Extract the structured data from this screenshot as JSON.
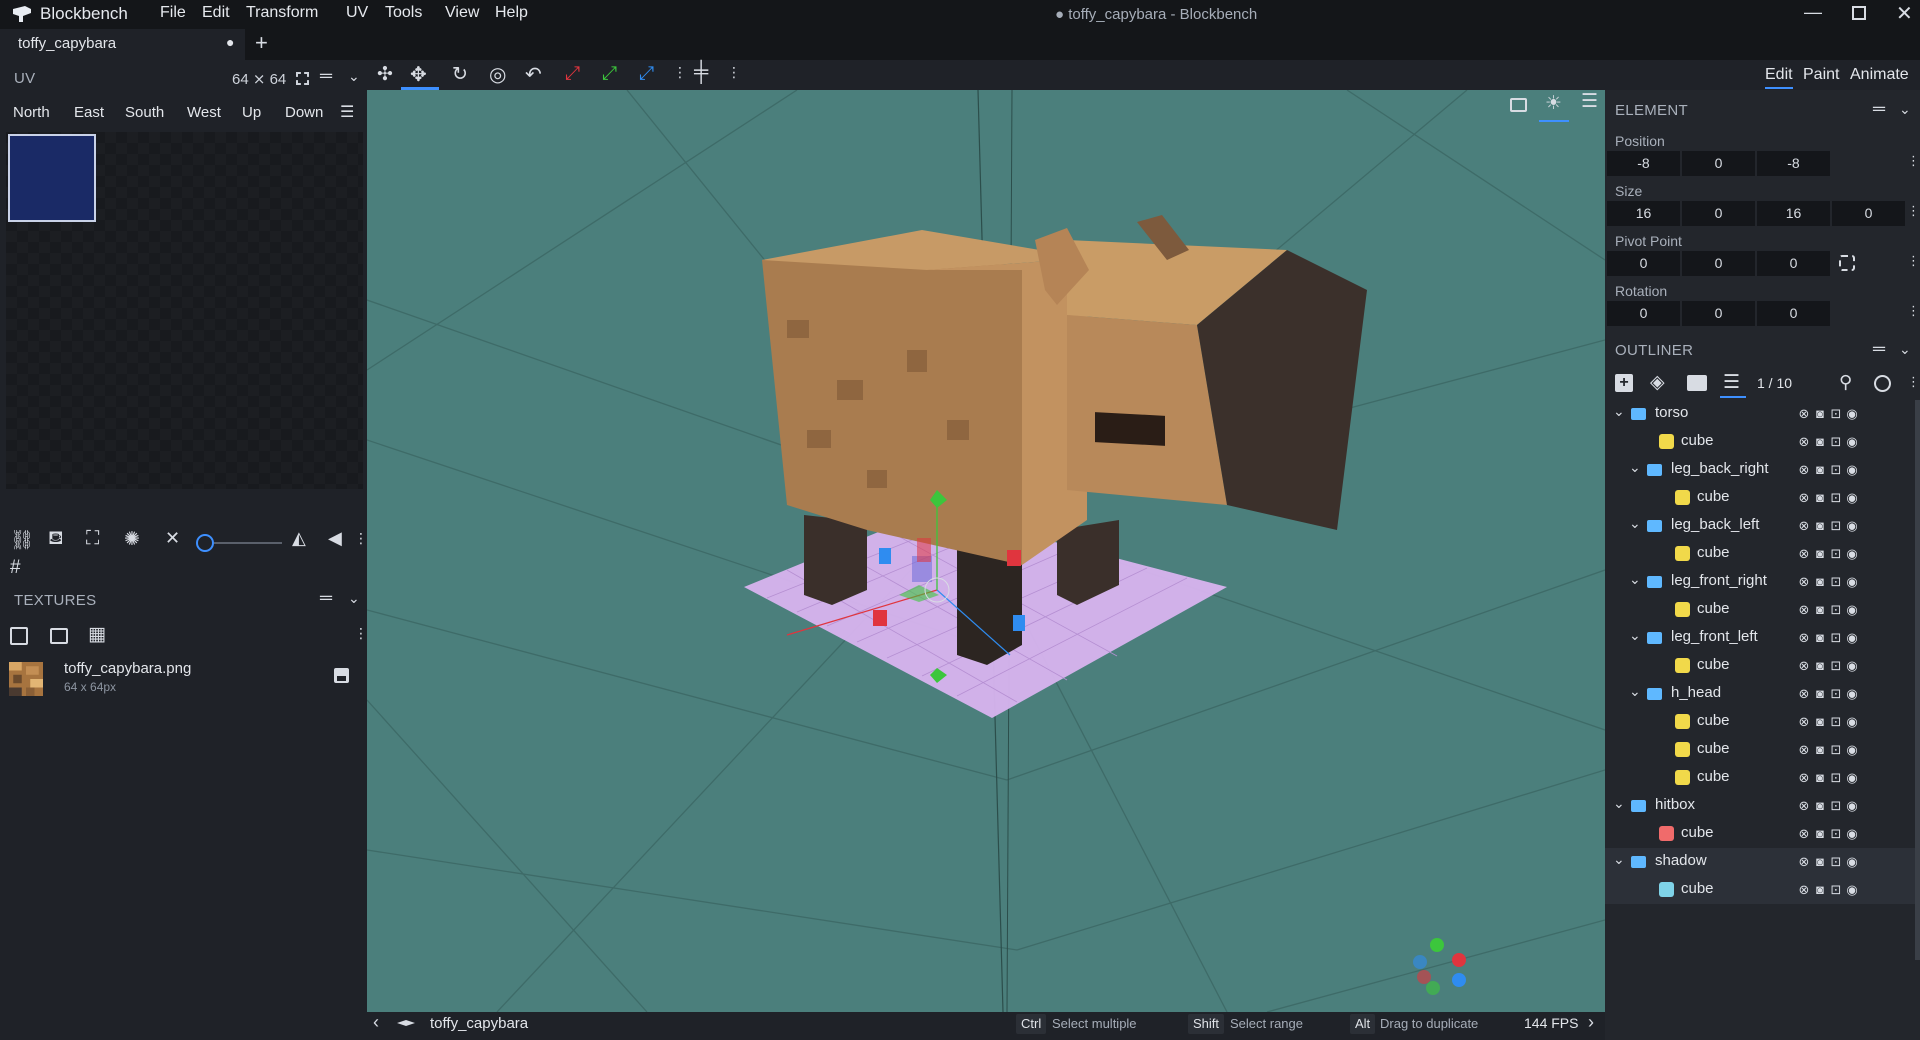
{
  "app": {
    "name": "Blockbench",
    "window_title": "● toffy_capybara - Blockbench",
    "menu": [
      "File",
      "Edit",
      "Transform",
      "UV",
      "Tools",
      "View",
      "Help"
    ]
  },
  "tabs": [
    {
      "label": "toffy_capybara",
      "unsaved": "●"
    }
  ],
  "toolbar": {
    "modes": [
      "Edit",
      "Paint",
      "Animate"
    ],
    "active_mode": "Edit"
  },
  "uv_panel": {
    "title": "UV",
    "size_label": "64 ⨯ 64",
    "faces": [
      "North",
      "East",
      "South",
      "West",
      "Up",
      "Down"
    ]
  },
  "textures_panel": {
    "title": "TEXTURES",
    "items": [
      {
        "name": "toffy_capybara.png",
        "dims": "64 x 64px"
      }
    ]
  },
  "element_panel": {
    "title": "ELEMENT",
    "position": {
      "label": "Position",
      "values": [
        "-8",
        "0",
        "-8"
      ]
    },
    "size": {
      "label": "Size",
      "values": [
        "16",
        "0",
        "16",
        "0"
      ]
    },
    "pivot": {
      "label": "Pivot Point",
      "values": [
        "0",
        "0",
        "0"
      ]
    },
    "rotation": {
      "label": "Rotation",
      "values": [
        "0",
        "0",
        "0"
      ]
    }
  },
  "outliner": {
    "title": "OUTLINER",
    "count": "1 / 10",
    "items": [
      {
        "name": "torso",
        "type": "group",
        "depth": 0
      },
      {
        "name": "cube",
        "type": "cube",
        "depth": 1,
        "color": "#f1d94a"
      },
      {
        "name": "leg_back_right",
        "type": "group",
        "depth": 1
      },
      {
        "name": "cube",
        "type": "cube",
        "depth": 2,
        "color": "#f1d94a"
      },
      {
        "name": "leg_back_left",
        "type": "group",
        "depth": 1
      },
      {
        "name": "cube",
        "type": "cube",
        "depth": 2,
        "color": "#f1d94a"
      },
      {
        "name": "leg_front_right",
        "type": "group",
        "depth": 1
      },
      {
        "name": "cube",
        "type": "cube",
        "depth": 2,
        "color": "#f1d94a"
      },
      {
        "name": "leg_front_left",
        "type": "group",
        "depth": 1
      },
      {
        "name": "cube",
        "type": "cube",
        "depth": 2,
        "color": "#f1d94a"
      },
      {
        "name": "h_head",
        "type": "group",
        "depth": 1
      },
      {
        "name": "cube",
        "type": "cube",
        "depth": 2,
        "color": "#f1d94a"
      },
      {
        "name": "cube",
        "type": "cube",
        "depth": 2,
        "color": "#f1d94a"
      },
      {
        "name": "cube",
        "type": "cube",
        "depth": 2,
        "color": "#f1d94a"
      },
      {
        "name": "hitbox",
        "type": "group",
        "depth": 0
      },
      {
        "name": "cube",
        "type": "cube",
        "depth": 1,
        "color": "#f06b6b"
      },
      {
        "name": "shadow",
        "type": "group",
        "depth": 0,
        "selected": true
      },
      {
        "name": "cube",
        "type": "cube",
        "depth": 1,
        "color": "#7fd3e8",
        "selected": true
      }
    ]
  },
  "statusbar": {
    "model_name": "toffy_capybara",
    "hints": [
      {
        "key": "Ctrl",
        "text": "Select multiple"
      },
      {
        "key": "Shift",
        "text": "Select range"
      },
      {
        "key": "Alt",
        "text": "Drag to duplicate"
      }
    ],
    "fps": "144 FPS"
  },
  "colors": {
    "accent": "#3e90ff",
    "viewport_bg": "#4b7f7c",
    "panel_bg": "#1f2228",
    "selected_row": "#2c3038"
  }
}
